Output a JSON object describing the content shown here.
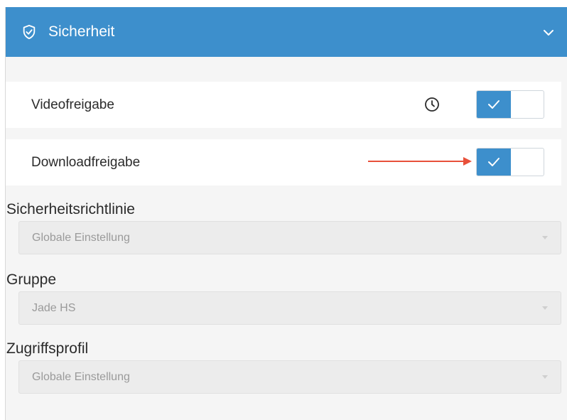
{
  "header": {
    "title": "Sicherheit"
  },
  "rows": [
    {
      "label": "Videofreigabe",
      "enabled": true,
      "has_schedule_icon": true
    },
    {
      "label": "Downloadfreigabe",
      "enabled": true,
      "has_schedule_icon": false
    }
  ],
  "fields": [
    {
      "label": "Sicherheitsrichtlinie",
      "value": "Globale Einstellung"
    },
    {
      "label": "Gruppe",
      "value": "Jade HS"
    },
    {
      "label": "Zugriffsprofil",
      "value": "Globale Einstellung"
    }
  ],
  "icons": {
    "header": "shield-check-icon",
    "collapse": "chevron-down-icon",
    "schedule": "clock-icon",
    "toggle_on": "checkmark-icon",
    "annotation": "red-arrow-icon",
    "dropdown": "caret-down-icon"
  },
  "colors": {
    "accent": "#3d8fcc",
    "annotation_arrow": "#e8503a",
    "panel_bg": "#f5f5f5",
    "disabled_field_bg": "#ececec",
    "disabled_text": "#9a9a9a"
  }
}
